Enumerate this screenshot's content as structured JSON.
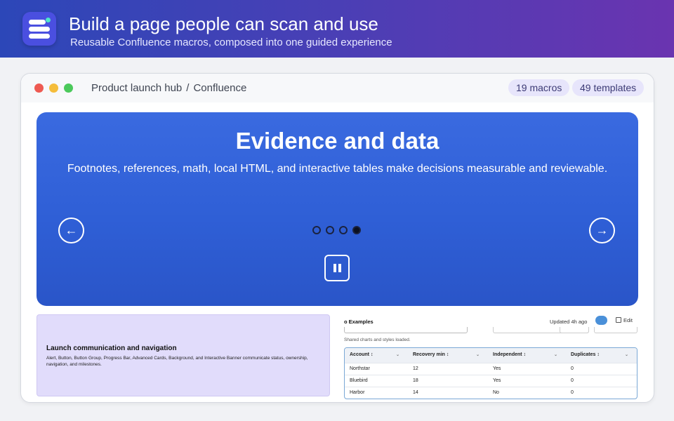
{
  "header": {
    "title": "Build a page people can scan and use",
    "subtitle": "Reusable Confluence macros, composed into one guided experience"
  },
  "window": {
    "breadcrumb": [
      "Product launch hub",
      "/",
      "Confluence"
    ],
    "badges": {
      "macros": "19 macros",
      "templates": "49 templates"
    }
  },
  "banner": {
    "title": "Evidence and data",
    "subtitle": "Footnotes, references, math, local HTML, and interactive tables make decisions measurable and reviewable.",
    "slide_count": 4,
    "active_slide": 4,
    "prev_icon": "←",
    "next_icon": "→",
    "background": "#3a6ae0"
  },
  "card": {
    "title": "Launch communication and navigation",
    "body": "Alert, Button, Button Group, Progress Bar, Advanced Cards, Background, and Interactive Banner communicate status, ownership, navigation, and milestones."
  },
  "panel": {
    "title": "o Examples",
    "updated": "Updated 4h ago",
    "edit_label": "Edit",
    "note": "Shared charts and styles loaded.",
    "table": {
      "headers": [
        "Account ↕",
        "Recovery min ↕",
        "Independent ↕",
        "Duplicates ↕"
      ],
      "rows": [
        [
          "Northstar",
          "12",
          "Yes",
          "0"
        ],
        [
          "Bluebird",
          "18",
          "Yes",
          "0"
        ],
        [
          "Harbor",
          "14",
          "No",
          "0"
        ]
      ]
    }
  }
}
